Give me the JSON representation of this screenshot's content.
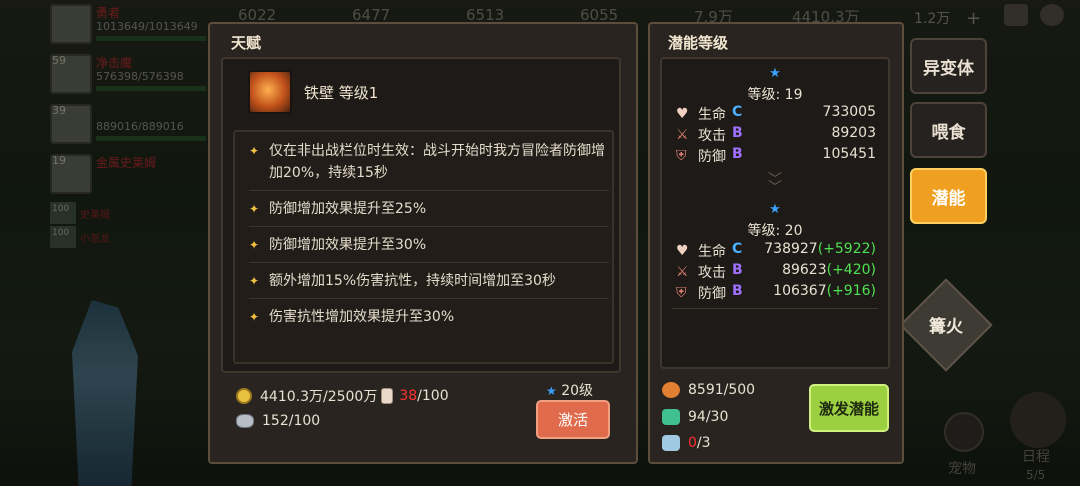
{
  "top_bar": {
    "values": [
      "6022",
      "6477",
      "6513",
      "6055",
      "7.9万",
      "4410.3万",
      "1.2万"
    ]
  },
  "heroes": [
    {
      "level": "",
      "name": "勇者",
      "hp": "1013649/1013649"
    },
    {
      "level": "59",
      "name": "净击魔",
      "hp": "576398/576398"
    },
    {
      "level": "39",
      "name": "",
      "hp": "889016/889016"
    },
    {
      "level": "19",
      "name": "金属史莱姆",
      "hp": ""
    }
  ],
  "small_heroes": [
    {
      "level": "100",
      "name": "史莱姆"
    },
    {
      "level": "100",
      "name": "小恶龙"
    }
  ],
  "talent_panel": {
    "title": "天赋",
    "talent_name": "铁壁 等级1",
    "descriptions": [
      "仅在非出战栏位时生效：战斗开始时我方冒险者防御增加20%，持续15秒",
      "防御增加效果提升至25%",
      "防御增加效果提升至30%",
      "额外增加15%伤害抗性，持续时间增加至30秒",
      "伤害抗性增加效果提升至30%"
    ],
    "coin_text": "4410.3万/2500万",
    "bottle_current": "38",
    "bottle_total": "/100",
    "stone_text": "152/100",
    "required_level": "20级",
    "activate_label": "激活"
  },
  "potential_panel": {
    "title": "潜能等级",
    "current": {
      "level_text": "等级: 19",
      "stats": [
        {
          "icon": "heart-icon",
          "label": "生命",
          "grade": "C",
          "value": "733005",
          "plus": ""
        },
        {
          "icon": "sword-icon",
          "label": "攻击",
          "grade": "B",
          "value": "89203",
          "plus": ""
        },
        {
          "icon": "shield-icon",
          "label": "防御",
          "grade": "B",
          "value": "105451",
          "plus": ""
        }
      ]
    },
    "next": {
      "level_text": "等级: 20",
      "stats": [
        {
          "icon": "heart-icon",
          "label": "生命",
          "grade": "C",
          "value": "738927",
          "plus": "(+5922)"
        },
        {
          "icon": "sword-icon",
          "label": "攻击",
          "grade": "B",
          "value": "89623",
          "plus": "(+420)"
        },
        {
          "icon": "shield-icon",
          "label": "防御",
          "grade": "B",
          "value": "106367",
          "plus": "(+916)"
        }
      ]
    },
    "resources": [
      {
        "icon": "potion-icon",
        "text": "8591/500"
      },
      {
        "icon": "gem-icon",
        "text": "94/30"
      },
      {
        "icon": "ticket-icon",
        "current": "0",
        "total": "/3"
      }
    ],
    "inspire_label": "激发潜能"
  },
  "side_buttons": {
    "mutation": "异变体",
    "feed": "喂食",
    "potential": "潜能",
    "campfire": "篝火"
  },
  "bottom_tabs": {
    "pet": "宠物",
    "schedule": "日程",
    "schedule_count": "5/5"
  },
  "colors": {
    "accent_orange": "#f0a020",
    "activate_button": "#e06a4c",
    "inspire_button": "#9cd040",
    "grade_c": "#4ab0ff",
    "grade_b": "#a070ff",
    "plus_green": "#50e050"
  }
}
